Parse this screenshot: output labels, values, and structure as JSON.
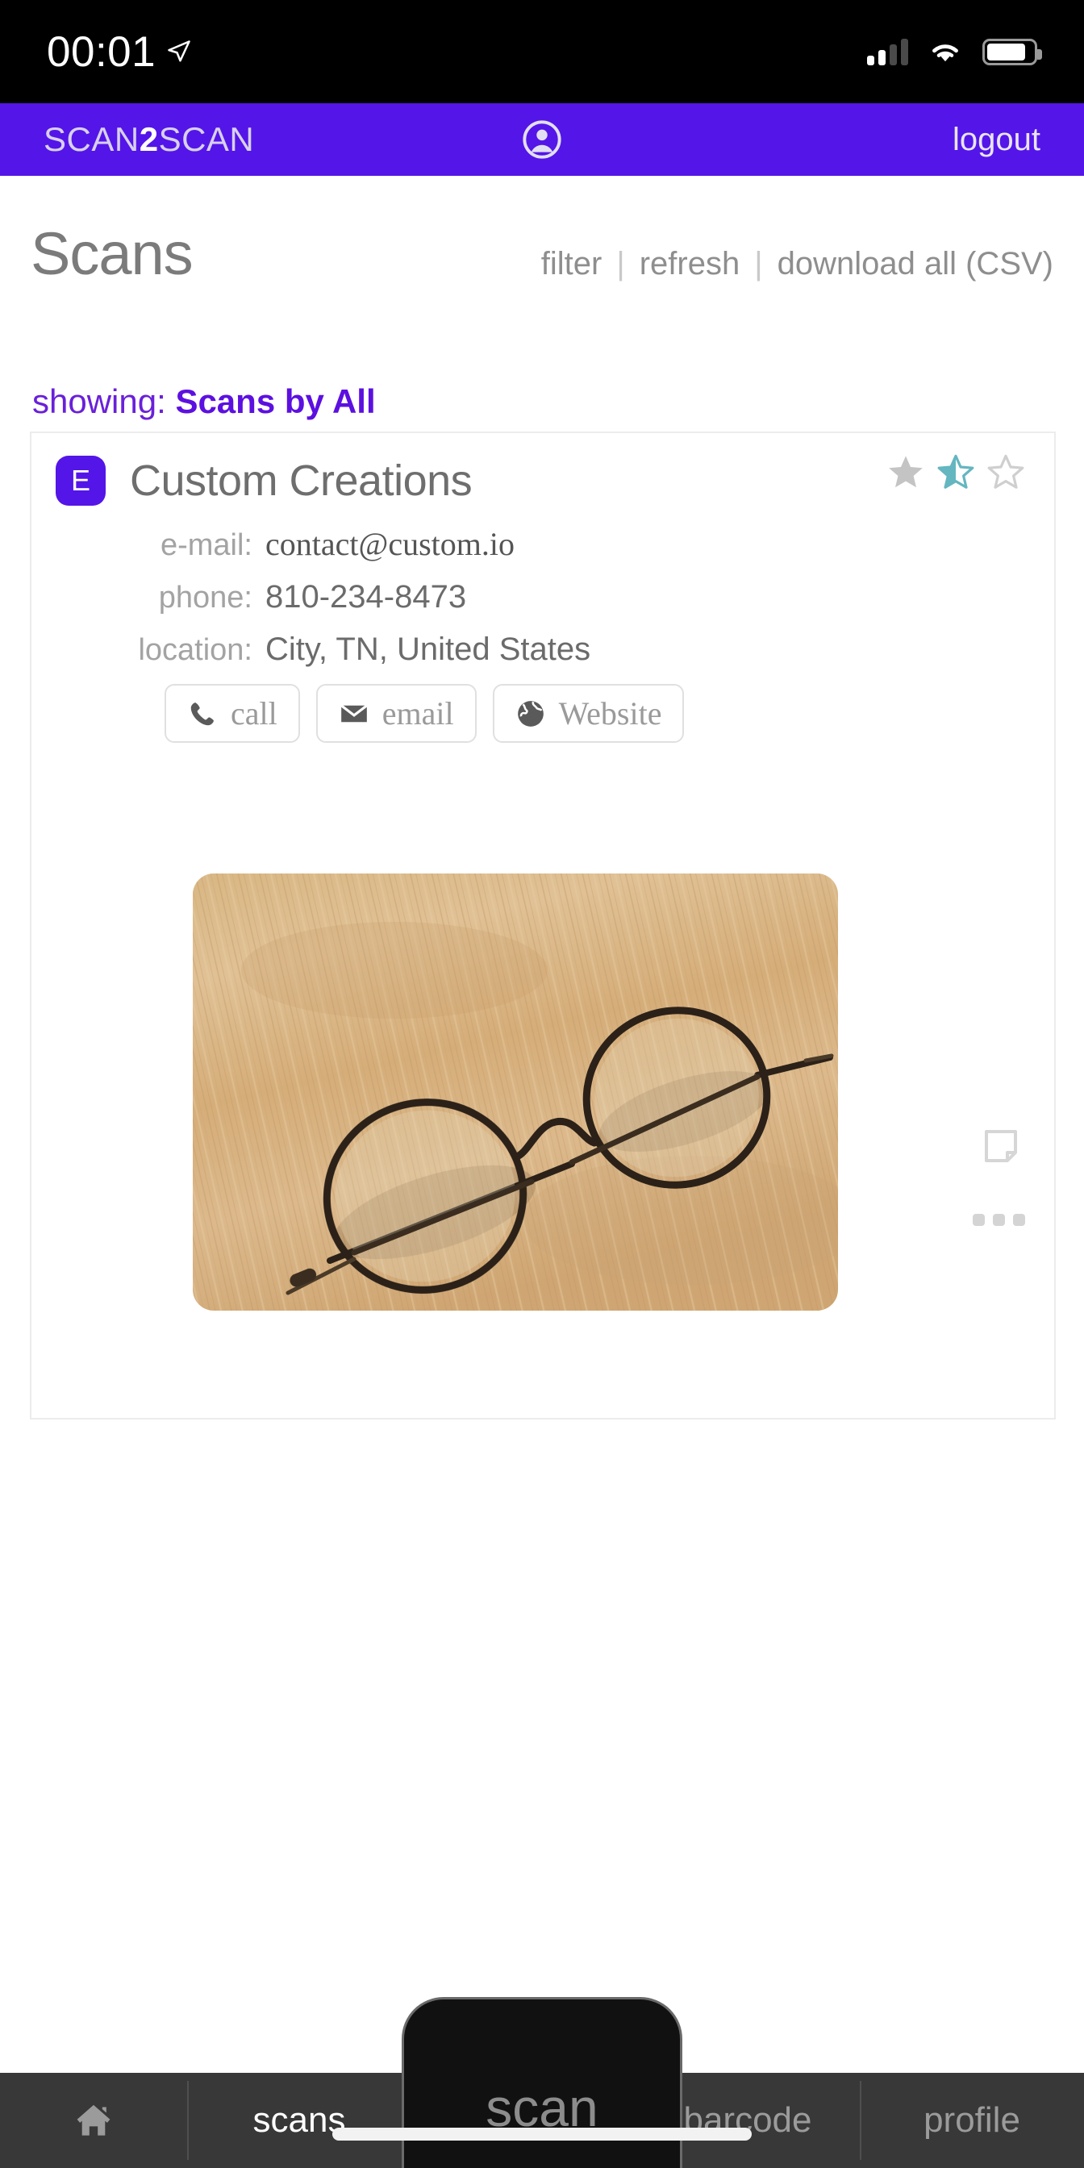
{
  "status_bar": {
    "time": "00:01",
    "location_icon": "location-arrow-icon",
    "signal_icon": "cellular-signal-icon",
    "signal_bars_filled": 2,
    "signal_bars_total": 4,
    "wifi_icon": "wifi-icon",
    "battery_icon": "battery-icon",
    "battery_level_percent": 84
  },
  "app_bar": {
    "brand_prefix": "SCAN",
    "brand_accent": "2",
    "brand_suffix": "SCAN",
    "account_icon": "account-circle-icon",
    "logout_label": "logout",
    "background_color": "#5415e8"
  },
  "page": {
    "title": "Scans",
    "actions": [
      {
        "label": "filter"
      },
      {
        "label": "refresh"
      },
      {
        "label": "download all (CSV)"
      }
    ],
    "action_separator": "|",
    "showing_label": "showing:",
    "showing_value": "Scans by All",
    "showing_color": "#6a20d8"
  },
  "scan_card": {
    "avatar_initial": "E",
    "avatar_color": "#5415e8",
    "business_name": "Custom Creations",
    "rating": {
      "stars_total": 3,
      "value": 1.5,
      "filled_color": "#bfbfbf",
      "half_color": "#64b6c0",
      "empty_color": "#cccccc"
    },
    "details": [
      {
        "label": "e-mail:",
        "value": "contact@custom.io"
      },
      {
        "label": "phone:",
        "value": "810-234-8473"
      },
      {
        "label": "location:",
        "value": "City, TN, United States"
      }
    ],
    "buttons": [
      {
        "icon": "phone-icon",
        "label": "call"
      },
      {
        "icon": "envelope-icon",
        "label": "email"
      },
      {
        "icon": "globe-icon",
        "label": "Website"
      }
    ],
    "note_icon": "sticky-note-icon",
    "more_icon": "ellipsis-icon",
    "photo_alt": "eyeglasses-on-wood-photo"
  },
  "tab_bar": {
    "background_color": "#383838",
    "items": [
      {
        "name": "home",
        "icon": "home-icon",
        "label": "",
        "active": false
      },
      {
        "name": "scans",
        "label": "scans",
        "active": true
      },
      {
        "name": "scan",
        "label": "scan",
        "active": false
      },
      {
        "name": "barcode",
        "label": "barcode",
        "active": false
      },
      {
        "name": "profile",
        "label": "profile",
        "active": false
      }
    ],
    "center_button_label": "scan"
  }
}
